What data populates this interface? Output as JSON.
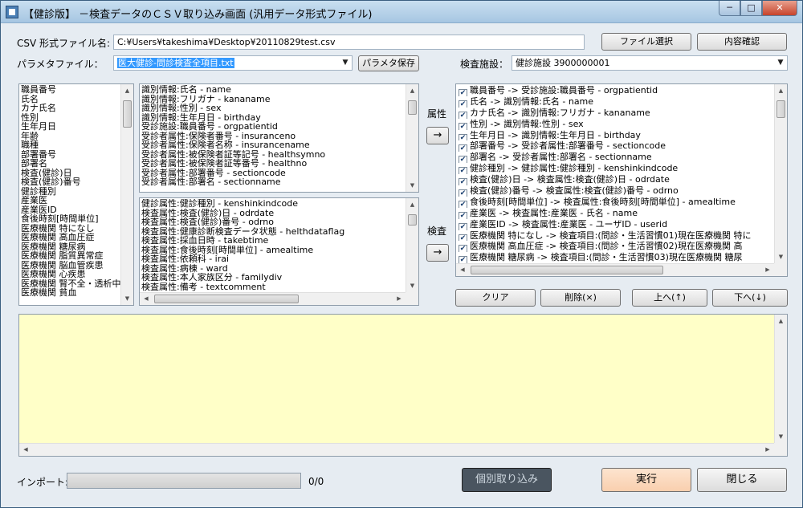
{
  "window": {
    "title": "【健診版】 －検査データのＣＳＶ取り込み画面 (汎用データ形式ファイル)",
    "minimize": "─",
    "maximize": "□",
    "close": "✕"
  },
  "csv": {
    "label": "CSV 形式ファイル名:",
    "value": "C:¥Users¥takeshima¥Desktop¥20110829test.csv",
    "select_button": "ファイル選択",
    "confirm_button": "内容確認"
  },
  "param": {
    "label": "パラメタファイル：",
    "value": "医大健診-問診検査全項目.txt",
    "save_button": "パラメタ保存"
  },
  "facility": {
    "label": "検査施設：",
    "value": "健診施設 3900000001"
  },
  "csv_columns": [
    "職員番号",
    "氏名",
    "カナ氏名",
    "性別",
    "生年月日",
    "年齢",
    "職種",
    "部署番号",
    "部署名",
    "検査(健診)日",
    "検査(健診)番号",
    "健診種別",
    "産業医",
    "産業医ID",
    "食後時刻[時間単位]",
    "医療機関 特になし",
    "医療機関 高血圧症",
    "医療機関 糖尿病",
    "医療機関 脂質異常症",
    "医療機関 脳血管疾患",
    "医療機関 心疾患",
    "医療機関 腎不全・透析中",
    "医療機関 貧血"
  ],
  "attribute_items": [
    "識別情報:氏名 - name",
    "識別情報:フリガナ - kananame",
    "識別情報:性別 - sex",
    "識別情報:生年月日 - birthday",
    "受診施設:職員番号 - orgpatientid",
    "受診者属性:保険者番号 - insuranceno",
    "受診者属性:保険者名称 - insurancename",
    "受診者属性:被保険者証等記号 - healthsymno",
    "受診者属性:被保険者証等番号 - healthno",
    "受診者属性:部署番号 - sectioncode",
    "受診者属性:部署名 - sectionname"
  ],
  "exam_items": [
    "健診属性:健診種別 - kenshinkindcode",
    "検査属性:検査(健診)日 - odrdate",
    "検査属性:検査(健診)番号 - odrno",
    "検査属性:健康診断検査データ状態 - helthdataflag",
    "検査属性:採血日時 - takebtime",
    "検査属性:食後時刻[時間単位] - amealtime",
    "検査属性:依頼科 - irai",
    "検査属性:病棟 - ward",
    "検査属性:本人家族区分 - familydiv",
    "検査属性:備考 - textcomment"
  ],
  "mid_labels": {
    "attribute": "属性",
    "exam": "検査",
    "arrow": "→"
  },
  "mappings": [
    "職員番号 -> 受診施設:職員番号 - orgpatientid",
    "氏名 -> 識別情報:氏名 - name",
    "カナ氏名 -> 識別情報:フリガナ - kananame",
    "性別 -> 識別情報:性別 - sex",
    "生年月日 -> 識別情報:生年月日 - birthday",
    "部署番号 -> 受診者属性:部署番号 - sectioncode",
    "部署名 -> 受診者属性:部署名 - sectionname",
    "健診種別 -> 健診属性:健診種別 - kenshinkindcode",
    "検査(健診)日 -> 検査属性:検査(健診)日 - odrdate",
    "検査(健診)番号 -> 検査属性:検査(健診)番号 - odrno",
    "食後時刻[時間単位] -> 検査属性:食後時刻[時間単位] - amealtime",
    "産業医 -> 検査属性:産業医 - 氏名 - name",
    "産業医ID -> 検査属性:産業医 - ユーザID - userid",
    "医療機関 特になし -> 検査項目:(問診・生活習慣01)現在医療機関 特に",
    "医療機関 高血圧症 -> 検査項目:(問診・生活習慣02)現在医療機関 高",
    "医療機関 糖尿病 -> 検査項目:(問診・生活習慣03)現在医療機関 糖尿"
  ],
  "mapping_buttons": {
    "clear": "クリア",
    "delete": "削除(×)",
    "up": "上へ(↑)",
    "down": "下へ(↓)"
  },
  "bottom": {
    "import_label": "インポート:",
    "progress_text": "0/0",
    "progress_fraction": 0,
    "individual_button": "個別取り込み",
    "run_button": "実行",
    "close_button": "閉じる"
  }
}
